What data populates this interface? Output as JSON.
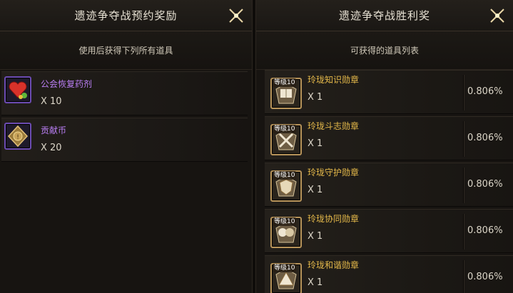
{
  "left_panel": {
    "title": "遗迹争夺战预约奖励",
    "subtitle": "使用后获得下列所有道具",
    "items": [
      {
        "name": "公会恢复药剂",
        "qty": "X 10",
        "icon": "heart-potion-icon"
      },
      {
        "name": "贡献币",
        "qty": "X 20",
        "icon": "contribution-coin-icon"
      }
    ]
  },
  "right_panel": {
    "title": "遗迹争夺战胜利奖",
    "subtitle": "可获得的道具列表",
    "items": [
      {
        "level": "等级10",
        "name": "玲珑知识勋章",
        "qty": "X 1",
        "pct": "0.806%",
        "icon": "book-medal-icon"
      },
      {
        "level": "等级10",
        "name": "玲珑斗志勋章",
        "qty": "X 1",
        "pct": "0.806%",
        "icon": "crossed-swords-medal-icon"
      },
      {
        "level": "等级10",
        "name": "玲珑守护勋章",
        "qty": "X 1",
        "pct": "0.806%",
        "icon": "shield-medal-icon"
      },
      {
        "level": "等级10",
        "name": "玲珑协同勋章",
        "qty": "X 1",
        "pct": "0.806%",
        "icon": "cooperation-medal-icon"
      },
      {
        "level": "等级10",
        "name": "玲珑和谐勋章",
        "qty": "X 1",
        "pct": "0.806%",
        "icon": "harmony-medal-icon"
      }
    ]
  },
  "colors": {
    "item_name_purple": "#b97ef3",
    "item_name_gold": "#e5b94a",
    "icon_frame_purple": "#6c4cb3",
    "icon_frame_gold": "#b8945a"
  }
}
